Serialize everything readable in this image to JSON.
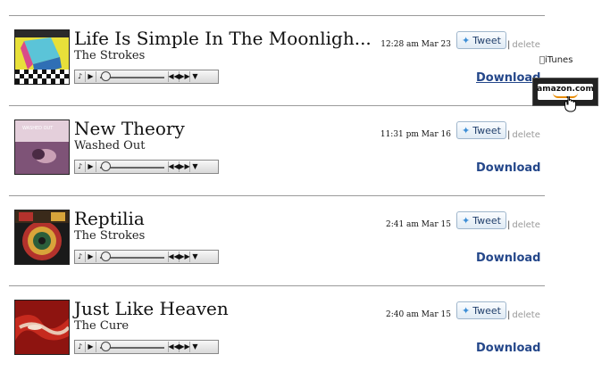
{
  "tracks": [
    {
      "title": "Life Is Simple In The Moonligh...",
      "artist": "The Strokes",
      "timestamp": "12:28 am Mar 23",
      "art": "strokes-angles"
    },
    {
      "title": "New Theory",
      "artist": "Washed Out",
      "timestamp": "11:31 pm Mar 16",
      "art": "washed-out-within-without"
    },
    {
      "title": "Reptilia",
      "artist": "The Strokes",
      "timestamp": "2:41 am Mar 15",
      "art": "strokes-room-on-fire"
    },
    {
      "title": "Just Like Heaven",
      "artist": "The Cure",
      "timestamp": "2:40 am Mar 15",
      "art": "cure-kiss-me"
    }
  ],
  "actions": {
    "tweet_label": "Tweet",
    "delete_label": "delete",
    "separator": "|",
    "download_label": "Download"
  },
  "store_popup": {
    "itunes_label": "iTunes",
    "amazon_label": "amazon.com"
  },
  "player_icons": [
    "speaker-icon",
    "play-icon",
    "seek-slider",
    "rewind-icon",
    "fast-forward-icon",
    "dropdown-icon"
  ],
  "colors": {
    "download": "#24478a",
    "tweet_text": "#1f3e6b",
    "delete": "#999999",
    "rule": "#9a9a9a",
    "amazon_bg": "#222222"
  }
}
